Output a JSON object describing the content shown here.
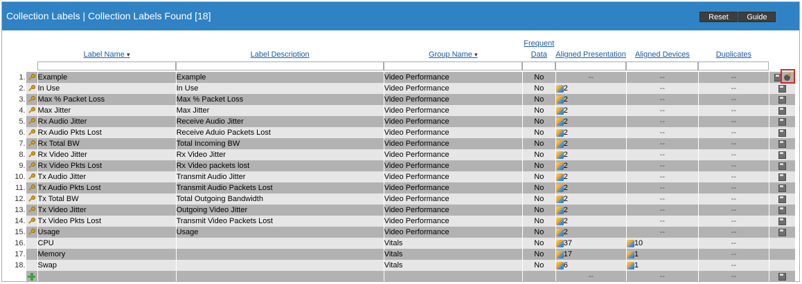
{
  "header": {
    "title": "Collection Labels | Collection Labels Found [18]",
    "reset_label": "Reset",
    "guide_label": "Guide"
  },
  "columns": {
    "label_name": "Label Name",
    "label_description": "Label Description",
    "group_name": "Group Name",
    "frequent_data": "Frequent Data",
    "aligned_presentations": "Aligned Presentations",
    "aligned_devices": "Aligned Devices",
    "duplicates": "Duplicates"
  },
  "sort_indicator": "▾",
  "rows": [
    {
      "num": "1.",
      "name": "Example",
      "desc": "Example",
      "group": "Video Performance",
      "freq": "No",
      "pres": "--",
      "devices": "--",
      "dups": "--",
      "key": true
    },
    {
      "num": "2.",
      "name": "In Use",
      "desc": "In Use",
      "group": "Video Performance",
      "freq": "No",
      "pres": "2",
      "devices": "--",
      "dups": "--",
      "key": true
    },
    {
      "num": "3.",
      "name": "Max % Packet Loss",
      "desc": "Max % Packet Loss",
      "group": "Video Performance",
      "freq": "No",
      "pres": "2",
      "devices": "--",
      "dups": "--",
      "key": true
    },
    {
      "num": "4.",
      "name": "Max Jitter",
      "desc": "Max Jitter",
      "group": "Video Performance",
      "freq": "No",
      "pres": "2",
      "devices": "--",
      "dups": "--",
      "key": true
    },
    {
      "num": "5.",
      "name": "Rx Audio Jitter",
      "desc": "Receive Audio Jitter",
      "group": "Video Performance",
      "freq": "No",
      "pres": "2",
      "devices": "--",
      "dups": "--",
      "key": true
    },
    {
      "num": "6.",
      "name": "Rx Audio Pkts Lost",
      "desc": "Receive Aduio Packets Lost",
      "group": "Video Performance",
      "freq": "No",
      "pres": "2",
      "devices": "--",
      "dups": "--",
      "key": true
    },
    {
      "num": "7.",
      "name": "Rx Total BW",
      "desc": "Total Incoming BW",
      "group": "Video Performance",
      "freq": "No",
      "pres": "2",
      "devices": "--",
      "dups": "--",
      "key": true
    },
    {
      "num": "8.",
      "name": "Rx Video Jitter",
      "desc": "Rx Video Jitter",
      "group": "Video Performance",
      "freq": "No",
      "pres": "2",
      "devices": "--",
      "dups": "--",
      "key": true
    },
    {
      "num": "9.",
      "name": "Rx Video Pkts Lost",
      "desc": "Rx Video packets lost",
      "group": "Video Performance",
      "freq": "No",
      "pres": "2",
      "devices": "--",
      "dups": "--",
      "key": true
    },
    {
      "num": "10.",
      "name": "Tx Audio Jitter",
      "desc": "Transmit Audio Jitter",
      "group": "Video Performance",
      "freq": "No",
      "pres": "2",
      "devices": "--",
      "dups": "--",
      "key": true
    },
    {
      "num": "11.",
      "name": "Tx Audio Pkts Lost",
      "desc": "Transmit Audio Packets Lost",
      "group": "Video Performance",
      "freq": "No",
      "pres": "2",
      "devices": "--",
      "dups": "--",
      "key": true
    },
    {
      "num": "12.",
      "name": "Tx Total BW",
      "desc": "Total Outgoing Bandwidth",
      "group": "Video Performance",
      "freq": "No",
      "pres": "2",
      "devices": "--",
      "dups": "--",
      "key": true
    },
    {
      "num": "13.",
      "name": "Tx Video Jitter",
      "desc": "Outgoing Video Jitter",
      "group": "Video Performance",
      "freq": "No",
      "pres": "2",
      "devices": "--",
      "dups": "--",
      "key": true
    },
    {
      "num": "14.",
      "name": "Tx Video Pkts Lost",
      "desc": "Transmit Video Packets Lost",
      "group": "Video Performance",
      "freq": "No",
      "pres": "2",
      "devices": "--",
      "dups": "--",
      "key": true
    },
    {
      "num": "15.",
      "name": "Usage",
      "desc": "Usage",
      "group": "Video Performance",
      "freq": "No",
      "pres": "2",
      "devices": "--",
      "dups": "--",
      "key": true
    },
    {
      "num": "16.",
      "name": "CPU",
      "desc": "",
      "group": "Vitals",
      "freq": "No",
      "pres": "37",
      "devices": "10",
      "dups": "--",
      "key": false
    },
    {
      "num": "17.",
      "name": "Memory",
      "desc": "",
      "group": "Vitals",
      "freq": "No",
      "pres": "17",
      "devices": "1",
      "dups": "--",
      "key": false
    },
    {
      "num": "18.",
      "name": "Swap",
      "desc": "",
      "group": "Vitals",
      "freq": "No",
      "pres": "6",
      "devices": "1",
      "dups": "--",
      "key": false
    }
  ],
  "footer_row": {
    "pres": "--",
    "devices": "--",
    "dups": "--"
  }
}
